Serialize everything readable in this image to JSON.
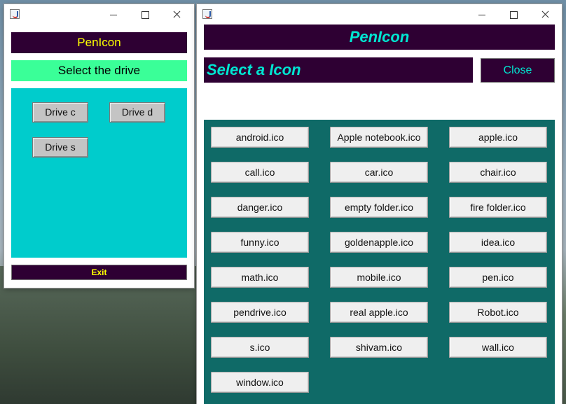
{
  "drive_window": {
    "title": "PenIcon",
    "heading": "Select the drive",
    "drives": [
      "Drive c",
      "Drive d",
      "Drive s"
    ],
    "exit_label": "Exit"
  },
  "icon_window": {
    "title": "PenIcon",
    "heading": "Select a Icon",
    "close_label": "Close",
    "icons": [
      "android.ico",
      "Apple notebook.ico",
      "apple.ico",
      "call.ico",
      "car.ico",
      "chair.ico",
      "danger.ico",
      "empty folder.ico",
      "fire folder.ico",
      "funny.ico",
      "goldenapple.ico",
      "idea.ico",
      "math.ico",
      "mobile.ico",
      "pen.ico",
      "pendrive.ico",
      "real apple.ico",
      "Robot.ico",
      "s.ico",
      "shivam.ico",
      "wall.ico",
      "window.ico"
    ]
  },
  "colors": {
    "title_bg": "#2e0033",
    "title_text_left": "#ffff00",
    "title_text_right": "#00e6d2",
    "drive_heading_bg": "#3aff98",
    "drive_panel_bg": "#00cccc",
    "icon_panel_bg": "#0f6a67"
  },
  "icons": {
    "app_icon": "java-cup-icon",
    "minimize": "minimize-icon",
    "maximize": "maximize-icon",
    "close": "close-icon"
  }
}
